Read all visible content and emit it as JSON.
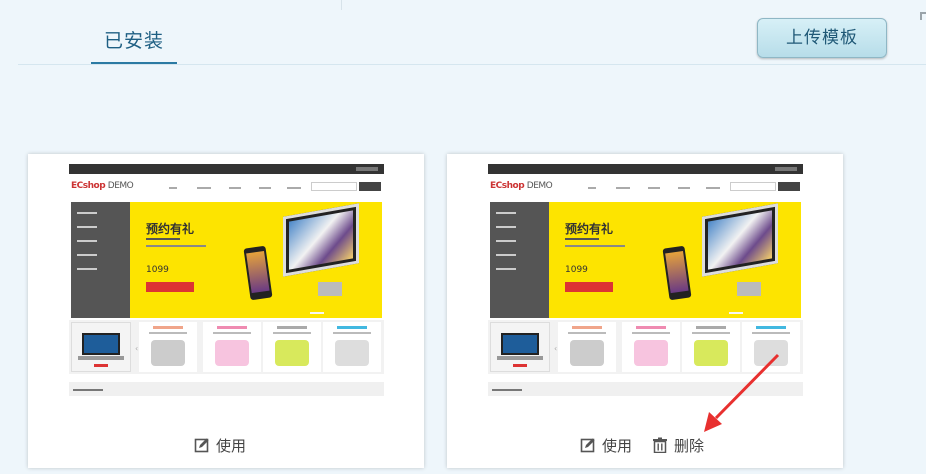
{
  "tabs": [
    {
      "label": "已安装",
      "active": true
    }
  ],
  "toolbar": {
    "upload_label": "上传模板"
  },
  "colors": {
    "accent": "#2b7aa3",
    "banner": "#fde400",
    "arrow": "#e8302f"
  },
  "templates": [
    {
      "thumbnail": {
        "logo": "ECshop",
        "logo_suffix": "DEMO",
        "banner_title": "预约有礼",
        "price": "1099"
      },
      "actions": [
        {
          "label": "使用",
          "icon": "edit-icon"
        }
      ]
    },
    {
      "thumbnail": {
        "logo": "ECshop",
        "logo_suffix": "DEMO",
        "banner_title": "预约有礼",
        "price": "1099"
      },
      "actions": [
        {
          "label": "使用",
          "icon": "edit-icon"
        },
        {
          "label": "删除",
          "icon": "trash-icon"
        }
      ]
    }
  ]
}
